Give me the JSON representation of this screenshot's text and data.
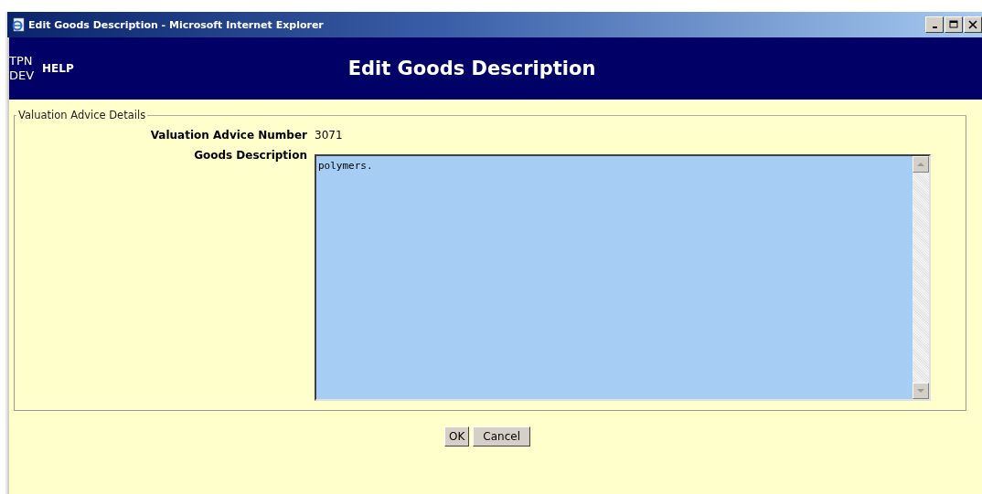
{
  "window": {
    "title": "Edit Goods Description - Microsoft Internet Explorer"
  },
  "header": {
    "env": "TPN DEV",
    "help": "HELP",
    "title": "Edit Goods Description"
  },
  "fieldset": {
    "legend": "Valuation Advice Details",
    "fields": [
      {
        "kind": "text",
        "label": "Valuation Advice Number",
        "value": "3071"
      },
      {
        "kind": "textarea",
        "label": "Goods Description",
        "value": "polymers."
      }
    ]
  },
  "buttons": [
    "OK",
    "Cancel"
  ]
}
